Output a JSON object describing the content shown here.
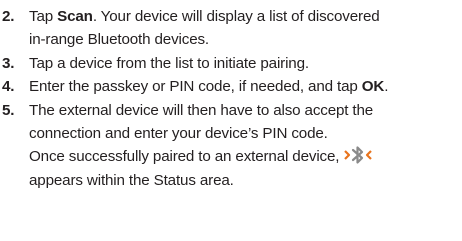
{
  "steps": [
    {
      "number": "2.",
      "parts": [
        "Tap ",
        "Scan",
        ". Your device will display a list of discovered"
      ],
      "continuation": "in-range Bluetooth devices."
    },
    {
      "number": "3.",
      "text": "Tap a device from the list to initiate pairing."
    },
    {
      "number": "4.",
      "parts": [
        "Enter the passkey or PIN code, if needed, and tap ",
        "OK",
        "."
      ]
    },
    {
      "number": "5.",
      "lines": [
        "The external device will then have to also accept the",
        "connection and enter your device’s PIN code."
      ],
      "note_before_icon": "Once successfully paired to an external device,",
      "note_after_icon": "appears within the Status area.",
      "icon": "bluetooth-connected-icon"
    }
  ],
  "colors": {
    "text": "#231f20",
    "icon_gray": "#8a8a8a",
    "icon_orange": "#e8731c"
  }
}
